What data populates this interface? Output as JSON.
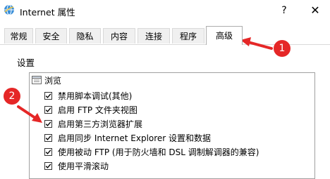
{
  "window": {
    "title": "Internet 属性",
    "help_glyph": "?",
    "close_glyph": "✕"
  },
  "tabs": [
    {
      "label": "常规"
    },
    {
      "label": "安全"
    },
    {
      "label": "隐私"
    },
    {
      "label": "内容"
    },
    {
      "label": "连接"
    },
    {
      "label": "程序"
    },
    {
      "label": "高级",
      "active": true
    }
  ],
  "settings": {
    "group_label": "设置",
    "category": "浏览",
    "items": [
      {
        "label": "禁用脚本调试(其他)",
        "checked": true
      },
      {
        "label": "启用 FTP 文件夹视图",
        "checked": true
      },
      {
        "label": "启用第三方浏览器扩展",
        "checked": true
      },
      {
        "label": "启用同步 Internet Explorer 设置和数据",
        "checked": true
      },
      {
        "label": "使用被动 FTP (用于防火墙和 DSL 调制解调器的兼容)",
        "checked": true
      },
      {
        "label": "使用平滑滚动",
        "checked": true
      }
    ]
  },
  "annotations": {
    "badge1": "1",
    "badge2": "2",
    "color": "#e52727"
  }
}
